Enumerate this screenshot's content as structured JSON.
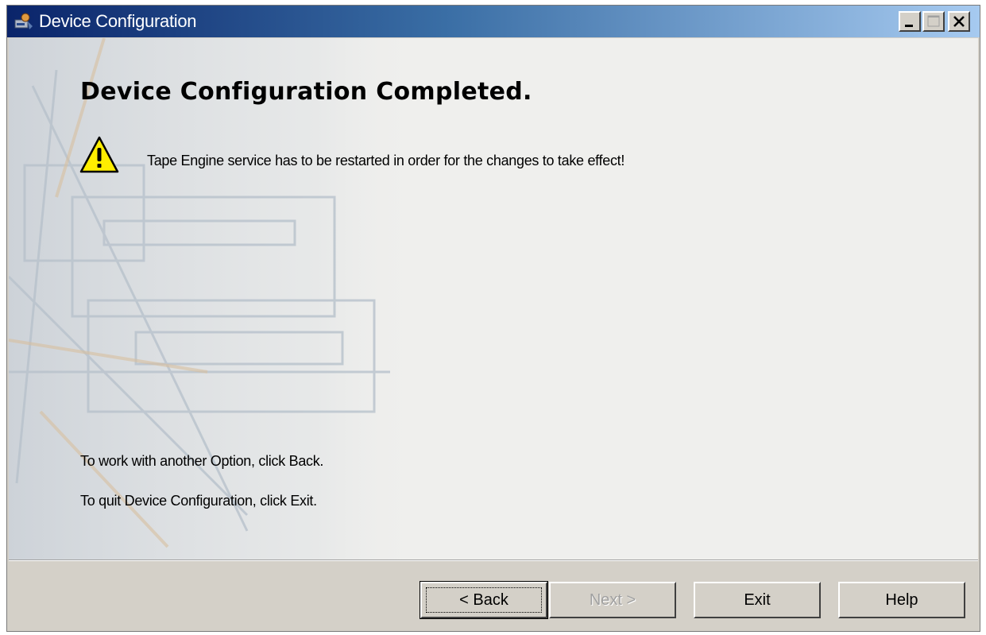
{
  "window": {
    "title": "Device Configuration",
    "icon": "device-config-app-icon",
    "controls": [
      "minimize-icon",
      "maximize-icon",
      "close-icon"
    ]
  },
  "content": {
    "heading": "Device Configuration Completed.",
    "warning": {
      "icon": "warning-triangle-icon",
      "text": "Tape Engine service has to be restarted in order for the changes to take effect!"
    },
    "hint_back": "To work with another Option, click Back.",
    "hint_exit": "To quit Device Configuration, click Exit."
  },
  "buttons": {
    "back": "< Back",
    "next": "Next >",
    "exit": "Exit",
    "help": "Help"
  },
  "colors": {
    "title_gradient_start": "#0a246a",
    "title_gradient_end": "#a6caf0",
    "warning_yellow": "#ffee00",
    "face": "#d4d0c8"
  }
}
